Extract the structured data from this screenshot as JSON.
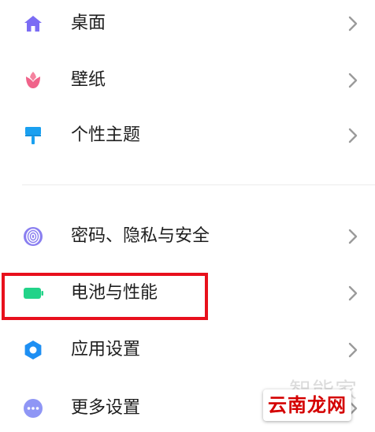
{
  "settings": {
    "items": [
      {
        "label": "桌面",
        "icon": "house-icon"
      },
      {
        "label": "壁纸",
        "icon": "tulip-icon"
      },
      {
        "label": "个性主题",
        "icon": "paint-roller-icon"
      },
      {
        "label": "密码、隐私与安全",
        "icon": "fingerprint-icon"
      },
      {
        "label": "电池与性能",
        "icon": "battery-icon"
      },
      {
        "label": "应用设置",
        "icon": "gear-icon"
      },
      {
        "label": "更多设置",
        "icon": "more-dots-icon"
      }
    ]
  },
  "colors": {
    "desktop_icon": "#7b6cf4",
    "wallpaper_icon": "#f0638a",
    "theme_icon": "#1aa0f0",
    "privacy_icon": "#8a7ff0",
    "battery_icon": "#22d389",
    "app_settings_icon": "#1e8ff3",
    "more_settings_icon": "#8f96f5",
    "label_text": "#1e1e1e",
    "chevron": "#9b9b9b",
    "highlight_border": "#e8101c",
    "watermark_text": "#d40000"
  },
  "watermark": {
    "faded_text": "智能家",
    "badge_text": "云南龙网"
  }
}
